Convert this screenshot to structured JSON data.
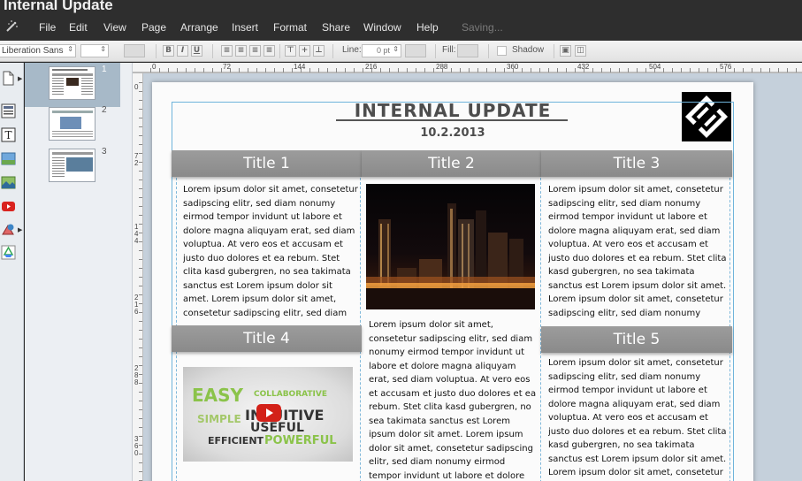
{
  "app": {
    "title": "Internal Update",
    "menu": [
      "File",
      "Edit",
      "View",
      "Page",
      "Arrange",
      "Insert",
      "Format",
      "Share",
      "Window",
      "Help"
    ],
    "status": "Saving..."
  },
  "toolbar": {
    "font_family": "Liberation Sans",
    "font_size": "",
    "bold": "B",
    "italic": "I",
    "underline": "U",
    "line_label": "Line:",
    "line_value": "0 pt",
    "fill_label": "Fill:",
    "shadow_label": "Shadow"
  },
  "tools": [
    "page-add-icon",
    "text-layout-icon",
    "text-box-icon",
    "image-icon",
    "image-alt-icon",
    "youtube-icon",
    "shapes-icon",
    "google-drive-icon"
  ],
  "pages": [
    {
      "number": "1",
      "selected": true
    },
    {
      "number": "2",
      "selected": false
    },
    {
      "number": "3",
      "selected": false
    }
  ],
  "rulers": {
    "top": [
      "0",
      "72",
      "144",
      "216",
      "288",
      "360",
      "432",
      "504",
      "576"
    ],
    "left": [
      "0",
      "7\n2",
      "1\n4\n4",
      "2\n1\n6",
      "2\n8\n8",
      "3\n6\n0"
    ]
  },
  "document": {
    "heading": "INTERNAL UPDATE",
    "date": "10.2.2013",
    "titles": [
      "Title 1",
      "Title 2",
      "Title 3",
      "Title 4",
      "Title 5"
    ],
    "col1_text": "Lorem ipsum dolor sit amet, consetetur sadipscing elitr, sed diam nonumy eirmod tempor invidunt ut labore et dolore magna aliquyam erat, sed diam voluptua. At vero eos et accusam et justo duo dolores et ea rebum. Stet clita kasd gubergren, no sea takimata sanctus est Lorem ipsum dolor sit amet. Lorem ipsum dolor sit amet, consetetur sadipscing elitr, sed diam nonumy eirmod tempor invidunt ut labore",
    "col2_text": "Lorem ipsum dolor sit amet, consetetur sadipscing elitr, sed diam nonumy eirmod tempor invidunt ut labore et dolore magna aliquyam erat, sed diam voluptua. At vero eos et accusam et justo duo dolores et ea rebum. Stet clita kasd gubergren, no sea takimata sanctus est Lorem ipsum dolor sit amet. Lorem ipsum dolor sit amet, consetetur sadipscing elitr, sed diam nonumy eirmod tempor invidunt ut labore et dolore magna aliquyam erat, sed diam voluptua. At vero",
    "col3_text": "Lorem ipsum dolor sit amet, consetetur sadipscing elitr, sed diam nonumy eirmod tempor invidunt ut labore et dolore magna aliquyam erat, sed diam voluptua. At vero eos et accusam et justo duo dolores et ea rebum. Stet clita kasd gubergren, no sea takimata sanctus est Lorem ipsum dolor sit amet. Lorem ipsum dolor sit amet, consetetur sadipscing elitr, sed diam nonumy eirmod tempor invidunt ut labore et dolore magna aliquyam erat, sed diam voluptua.",
    "col5_text": "Lorem ipsum dolor sit amet, consetetur sadipscing elitr, sed diam nonumy eirmod tempor invidunt ut labore et dolore magna aliquyam erat, sed diam voluptua. At vero eos et accusam et justo duo dolores et ea rebum. Stet clita kasd gubergren, no sea takimata sanctus est Lorem ipsum dolor sit amet. Lorem ipsum dolor sit amet, consetetur sadipscing elitr, sed diam nonumy eirmod tempor invidunt ut labore",
    "video_words": [
      "EASY",
      "COLLABORATIVE",
      "SIMPLE",
      "INTUITIVE",
      "USEFUL",
      "EFFICIENT",
      "POWERFUL"
    ]
  },
  "colors": {
    "chrome_dark": "#2e2e2e",
    "title_bar_gray": "#8f8f8f",
    "guide_blue": "#6fb4db",
    "video_green": "#7cb342"
  }
}
